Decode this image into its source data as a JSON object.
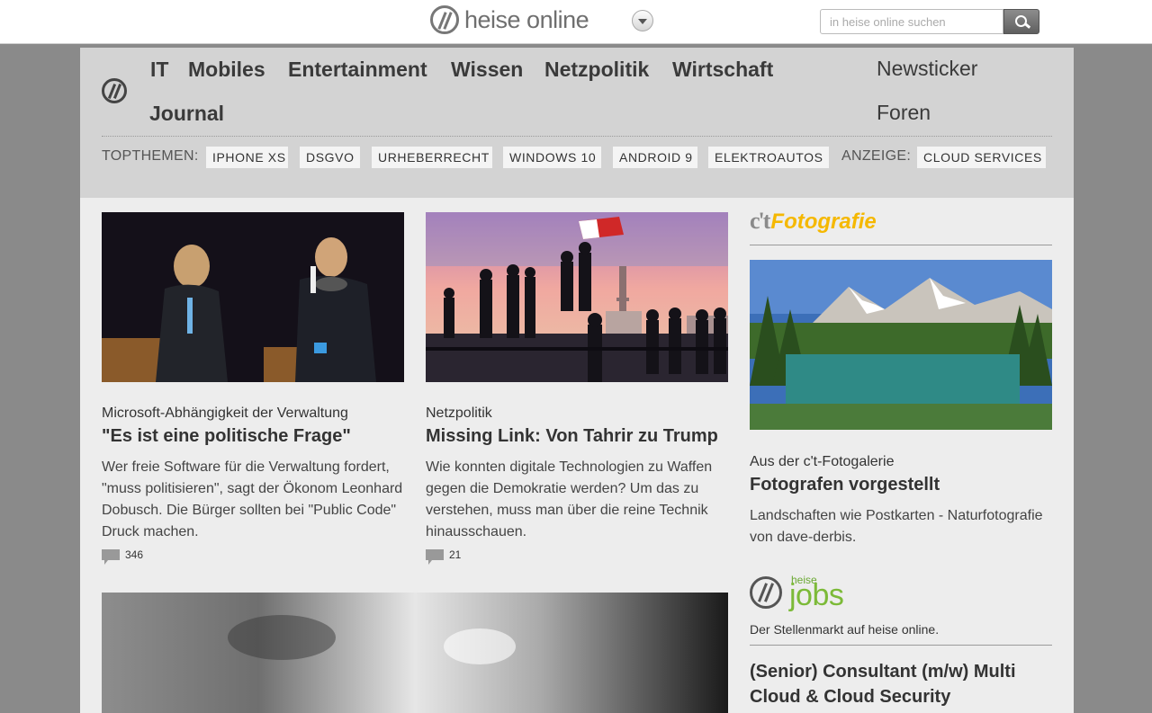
{
  "header": {
    "logo_text": "heise online",
    "search_placeholder": "in heise online suchen"
  },
  "nav": {
    "main_items": [
      "IT",
      "Mobiles",
      "Entertainment",
      "Wissen",
      "Netzpolitik",
      "Wirtschaft",
      "Journal"
    ],
    "right_items": [
      "Newsticker",
      "Foren"
    ],
    "topics_label": "TOPTHEMEN:",
    "topics": [
      "IPHONE XS",
      "DSGVO",
      "URHEBERRECHT",
      "WINDOWS 10",
      "ANDROID 9",
      "ELEKTROAUTOS"
    ],
    "ad_label": "ANZEIGE:",
    "ad_topic": "CLOUD SERVICES"
  },
  "articles": [
    {
      "kicker": "Microsoft-Abhängigkeit der Verwaltung",
      "title": "\"Es ist eine politische Frage\"",
      "teaser": "Wer freie Software für die Verwaltung fordert, \"muss politisieren\", sagt der Ökonom Leonhard Dobusch. Die Bürger sollten bei \"Public Code\" Druck machen.",
      "comments": "346"
    },
    {
      "kicker": "Netzpolitik",
      "title": "Missing Link: Von Tahrir zu Trump",
      "teaser": "Wie konnten digitale Technologien zu Waffen gegen die Demokratie werden? Um das zu verstehen, muss man über die reine Technik hinausschauen.",
      "comments": "21"
    }
  ],
  "sidebar": {
    "ct_brand": "c't",
    "ct_section": "Fotografie",
    "kicker": "Aus der c't-Fotogalerie",
    "title": "Fotografen vorgestellt",
    "teaser": "Landschaften wie Postkarten - Naturfotografie von dave-derbis.",
    "jobs_brand_small": "heise",
    "jobs_brand": "jobs",
    "jobs_subtitle": "Der Stellenmarkt auf heise online.",
    "job_title": "(Senior) Consultant (m/w) Multi Cloud & Cloud Security"
  }
}
